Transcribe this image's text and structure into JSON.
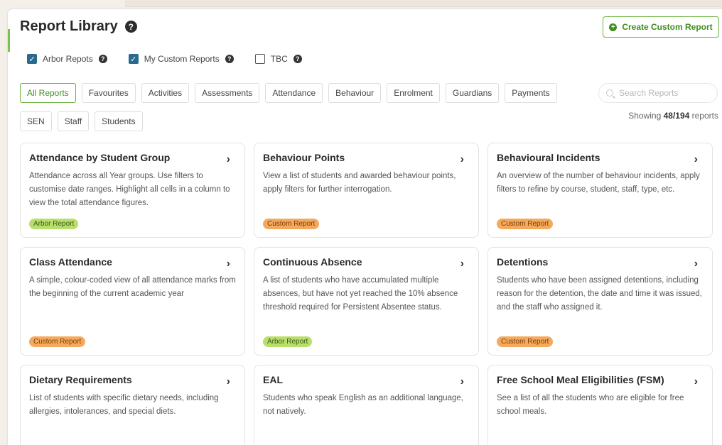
{
  "header": {
    "title": "Report Library",
    "create_label": "Create Custom Report"
  },
  "checkboxes": [
    {
      "label": "Arbor Repots",
      "checked": true
    },
    {
      "label": "My Custom Reports",
      "checked": true
    },
    {
      "label": "TBC",
      "checked": false
    }
  ],
  "filters": [
    "All Reports",
    "Favourites",
    "Activities",
    "Assessments",
    "Attendance",
    "Behaviour",
    "Enrolment",
    "Guardians",
    "Payments",
    "SEN",
    "Staff",
    "Students"
  ],
  "search": {
    "placeholder": "Search Reports"
  },
  "showing": {
    "prefix": "Showing",
    "count": "48/194",
    "suffix": "reports"
  },
  "cards": [
    {
      "title": "Attendance by Student Group",
      "desc": "Attendance across all Year groups. Use filters to customise date ranges. Highlight all cells in a column to view the total attendance figures.",
      "tag": "Arbor Report"
    },
    {
      "title": "Behaviour Points",
      "desc": "View a list of students and awarded behaviour points, apply filters for further interrogation.",
      "tag": "Custom Report"
    },
    {
      "title": "Behavioural Incidents",
      "desc": "An overview of the number of behaviour incidents, apply filters to refine by course, student, staff, type, etc.",
      "tag": "Custom Report"
    },
    {
      "title": "Class Attendance",
      "desc": "A simple, colour-coded view of all attendance marks from the beginning of the current academic year",
      "tag": "Custom Report"
    },
    {
      "title": "Continuous Absence",
      "desc": "A list of students who have accumulated multiple absences, but have not yet reached the 10% absence threshold required for Persistent Absentee status.",
      "tag": "Arbor Report"
    },
    {
      "title": "Detentions",
      "desc": "Students who have been assigned detentions, including reason for the detention, the date and time it was issued, and the staff who assigned it.",
      "tag": "Custom Report"
    },
    {
      "title": "Dietary Requirements",
      "desc": "List of students with specific dietary needs, including allergies, intolerances, and special diets.",
      "tag": ""
    },
    {
      "title": "EAL",
      "desc": "Students who speak English as an additional language, not natively.",
      "tag": ""
    },
    {
      "title": "Free School Meal Eligibilities (FSM)",
      "desc": "See a list of all the students who are eligible for free school meals.",
      "tag": ""
    }
  ]
}
